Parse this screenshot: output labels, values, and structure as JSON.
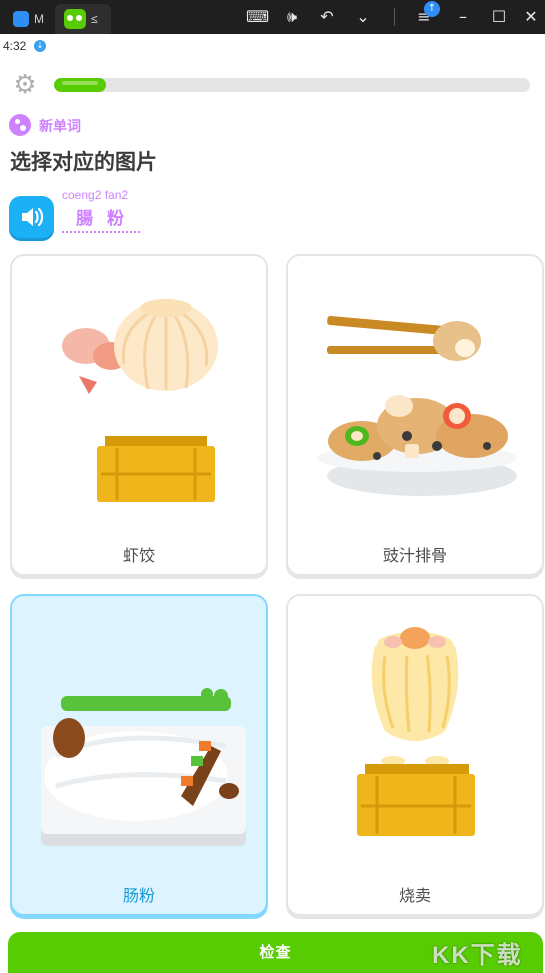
{
  "window": {
    "tab1_label": "M",
    "tab2_label": "≤",
    "upload_badge": "↑"
  },
  "status": {
    "time": "4:32",
    "download_icon": "↓"
  },
  "lesson": {
    "progress_fraction": 0.11,
    "badge_label": "新单词",
    "prompt": "选择对应的图片",
    "romanization": "coeng2 fan2",
    "word": "腸粉"
  },
  "choices": [
    {
      "label": "虾饺",
      "icon": "har-gow-dim-sum"
    },
    {
      "label": "豉汁排骨",
      "icon": "black-bean-spare-ribs"
    },
    {
      "label": "肠粉",
      "icon": "rice-noodle-roll",
      "selected": true
    },
    {
      "label": "烧卖",
      "icon": "siu-mai-dim-sum"
    }
  ],
  "actions": {
    "check_label": "检查"
  },
  "watermark": "KK下载",
  "colors": {
    "green": "#58cc02",
    "blue": "#1cb0f6",
    "purple": "#ce82ff",
    "selected_bg": "#ddf4ff"
  }
}
